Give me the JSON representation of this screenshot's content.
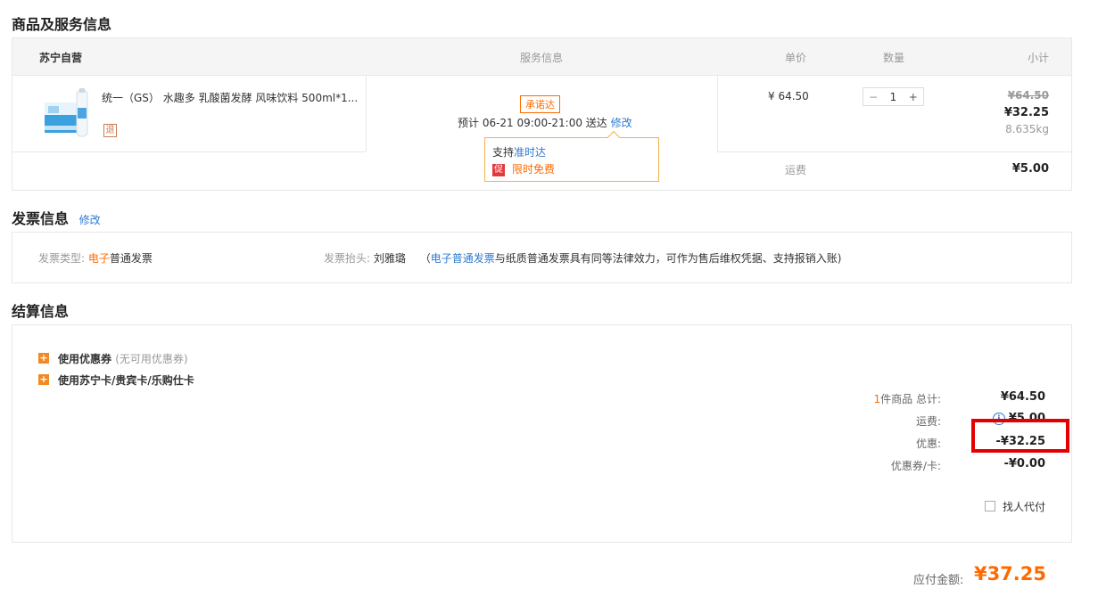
{
  "goods_section": {
    "title": "商品及服务信息",
    "headers": {
      "store": "苏宁自营",
      "service": "服务信息",
      "price": "单价",
      "quantity": "数量",
      "subtotal": "小计"
    },
    "product": {
      "name": "统一（GS） 水趣多 乳酸菌发酵 风味饮料 500ml*1...",
      "badge": "退",
      "promise_tag": "承诺达",
      "delivery_prefix": "预计 06-21 09:00-21:00  送达",
      "delivery_edit": "修改",
      "unit_price": "¥ 64.50",
      "quantity": "1",
      "original_subtotal": "¥64.50",
      "subtotal": "¥32.25",
      "weight": "8.635kg"
    },
    "popup": {
      "support_text": "支持",
      "support_link": "准时达",
      "promo_badge": "促",
      "promo_text": "限时免费"
    },
    "shipping": {
      "label": "运费",
      "value": "¥5.00"
    }
  },
  "invoice_section": {
    "title": "发票信息",
    "edit": "修改",
    "type_label": "发票类型:",
    "type_highlight": "电子",
    "type_rest": "普通发票",
    "header_label": "发票抬头:",
    "header_value": "刘雅璐",
    "note_open": "（",
    "note_link": "电子普通发票",
    "note_rest": "与纸质普通发票具有同等法律效力，可作为售后维权凭据、支持报销入账)"
  },
  "settlement_section": {
    "title": "结算信息",
    "coupon_label": "使用优惠券",
    "coupon_note": "(无可用优惠券)",
    "card_label": "使用苏宁卡/贵宾卡/乐购仕卡",
    "item_count": "1",
    "items_total_label": "件商品 总计:",
    "items_total": "¥64.50",
    "shipping_label": "运费:",
    "shipping_value": "¥5.00",
    "discount_label": "优惠:",
    "discount_value": "-¥32.25",
    "coupon_card_label": "优惠券/卡:",
    "coupon_card_value": "-¥0.00",
    "proxy_pay_label": "找人代付",
    "payable_label": "应付金额:",
    "payable_value": "¥37.25"
  },
  "colors": {
    "accent": "#ff6a00",
    "link": "#2d7ad3",
    "highlight_box": "#e50000"
  }
}
